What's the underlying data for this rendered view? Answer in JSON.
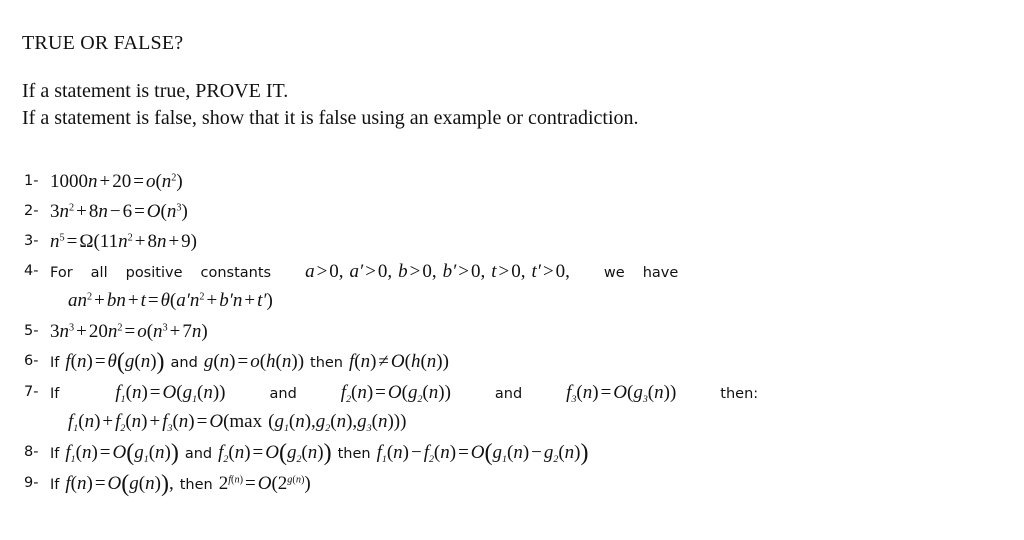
{
  "document": {
    "background_color": "#ffffff",
    "text_color": "#111111",
    "heading": {
      "title": "TRUE OR FALSE?",
      "line1": "If a statement is true, PROVE IT.",
      "line2": "If a statement is false, show that it is false using an example or contradiction."
    },
    "items": [
      {
        "number": "1-",
        "plain": "1000n + 20 = o(n²)",
        "parts": {
          "coef": "1000",
          "var": "n",
          "plus": "+",
          "const": "20",
          "eq": "=",
          "bound": "o",
          "arg_var": "n",
          "arg_exp": "2"
        }
      },
      {
        "number": "2-",
        "plain": "3n² + 8n − 6 = O(n³)",
        "parts": {
          "a": "3",
          "avar": "n",
          "aexp": "2",
          "plus": "+",
          "b": "8",
          "bvar": "n",
          "minus": "−",
          "c": "6",
          "eq": "=",
          "bound": "O",
          "arg_var": "n",
          "arg_exp": "3"
        }
      },
      {
        "number": "3-",
        "plain": "n⁵ = Ω(11n² + 8n + 9)",
        "parts": {
          "lhs_var": "n",
          "lhs_exp": "5",
          "eq": "=",
          "bound": "Ω",
          "t1": "11",
          "t1var": "n",
          "t1exp": "2",
          "plus1": "+",
          "t2": "8",
          "t2var": "n",
          "plus2": "+",
          "t3": "9"
        }
      },
      {
        "number": "4-",
        "plain": "For all positive constants a > 0, a' > 0, b > 0, b' > 0, t > 0, t' > 0, we have an² + bn + t = θ(a'n² + b'n + t')",
        "parts": {
          "w1": "For",
          "w2": "all",
          "w3": "positive",
          "w4": "constants",
          "c1": "a",
          "c2": "a′",
          "c3": "b",
          "c4": "b′",
          "c5": "t",
          "c6": "t′",
          "gt": ">",
          "zero": "0",
          "comma": ",",
          "w5": "we",
          "w6": "have",
          "l2_a": "a",
          "l2_n": "n",
          "l2_exp": "2",
          "l2_plus": "+",
          "l2_b": "b",
          "l2_t": "t",
          "l2_eq": "=",
          "l2_theta": "θ",
          "l2_ap": "a′",
          "l2_bp": "b′",
          "l2_tp": "t′"
        }
      },
      {
        "number": "5-",
        "plain": "3n³ + 20n² = o(n³ + 7n)",
        "parts": {
          "a": "3",
          "avar": "n",
          "aexp": "3",
          "plus": "+",
          "b": "20",
          "bvar": "n",
          "bexp": "2",
          "eq": "=",
          "bound": "o",
          "t1var": "n",
          "t1exp": "3",
          "plus2": "+",
          "t2": "7",
          "t2var": "n"
        }
      },
      {
        "number": "6-",
        "plain": "If f(n) = θ(g(n)) and g(n) = o(h(n)) then f(n) ≠ O(h(n))",
        "parts": {
          "if": "If",
          "and": "and",
          "then": "then",
          "f": "f",
          "g": "g",
          "h": "h",
          "n": "n",
          "eq": "=",
          "neq": "≠",
          "theta": "θ",
          "little_o": "o",
          "big_o": "O"
        }
      },
      {
        "number": "7-",
        "plain": "If f₁(n) = O(g₁(n)) and f₂(n) = O(g₂(n)) and f₃(n) = O(g₃(n)) then: f₁(n) + f₂(n) + f₃(n) = O(max (g₁(n), g₂(n), g₃(n)))",
        "parts": {
          "if": "If",
          "and": "and",
          "then": "then:",
          "f": "f",
          "g": "g",
          "n": "n",
          "s1": "1",
          "s2": "2",
          "s3": "3",
          "eq": "=",
          "plus": "+",
          "big_o": "O",
          "max": "max",
          "comma": ","
        }
      },
      {
        "number": "8-",
        "plain": "If f₁(n) = O(g₁(n)) and f₂(n) = O(g₂(n)) then f₁(n) − f₂(n) = O(g₁(n) − g₂(n))",
        "parts": {
          "if": "If",
          "and": "and",
          "then": "then",
          "f": "f",
          "g": "g",
          "n": "n",
          "s1": "1",
          "s2": "2",
          "eq": "=",
          "minus": "−",
          "big_o": "O"
        }
      },
      {
        "number": "9-",
        "plain": "If f(n) = O(g(n)), then 2^f(n) = O(2^g(n))",
        "parts": {
          "if": "If",
          "then": "then",
          "f": "f",
          "g": "g",
          "n": "n",
          "eq": "=",
          "big_o": "O",
          "two": "2",
          "comma": ","
        }
      }
    ]
  }
}
